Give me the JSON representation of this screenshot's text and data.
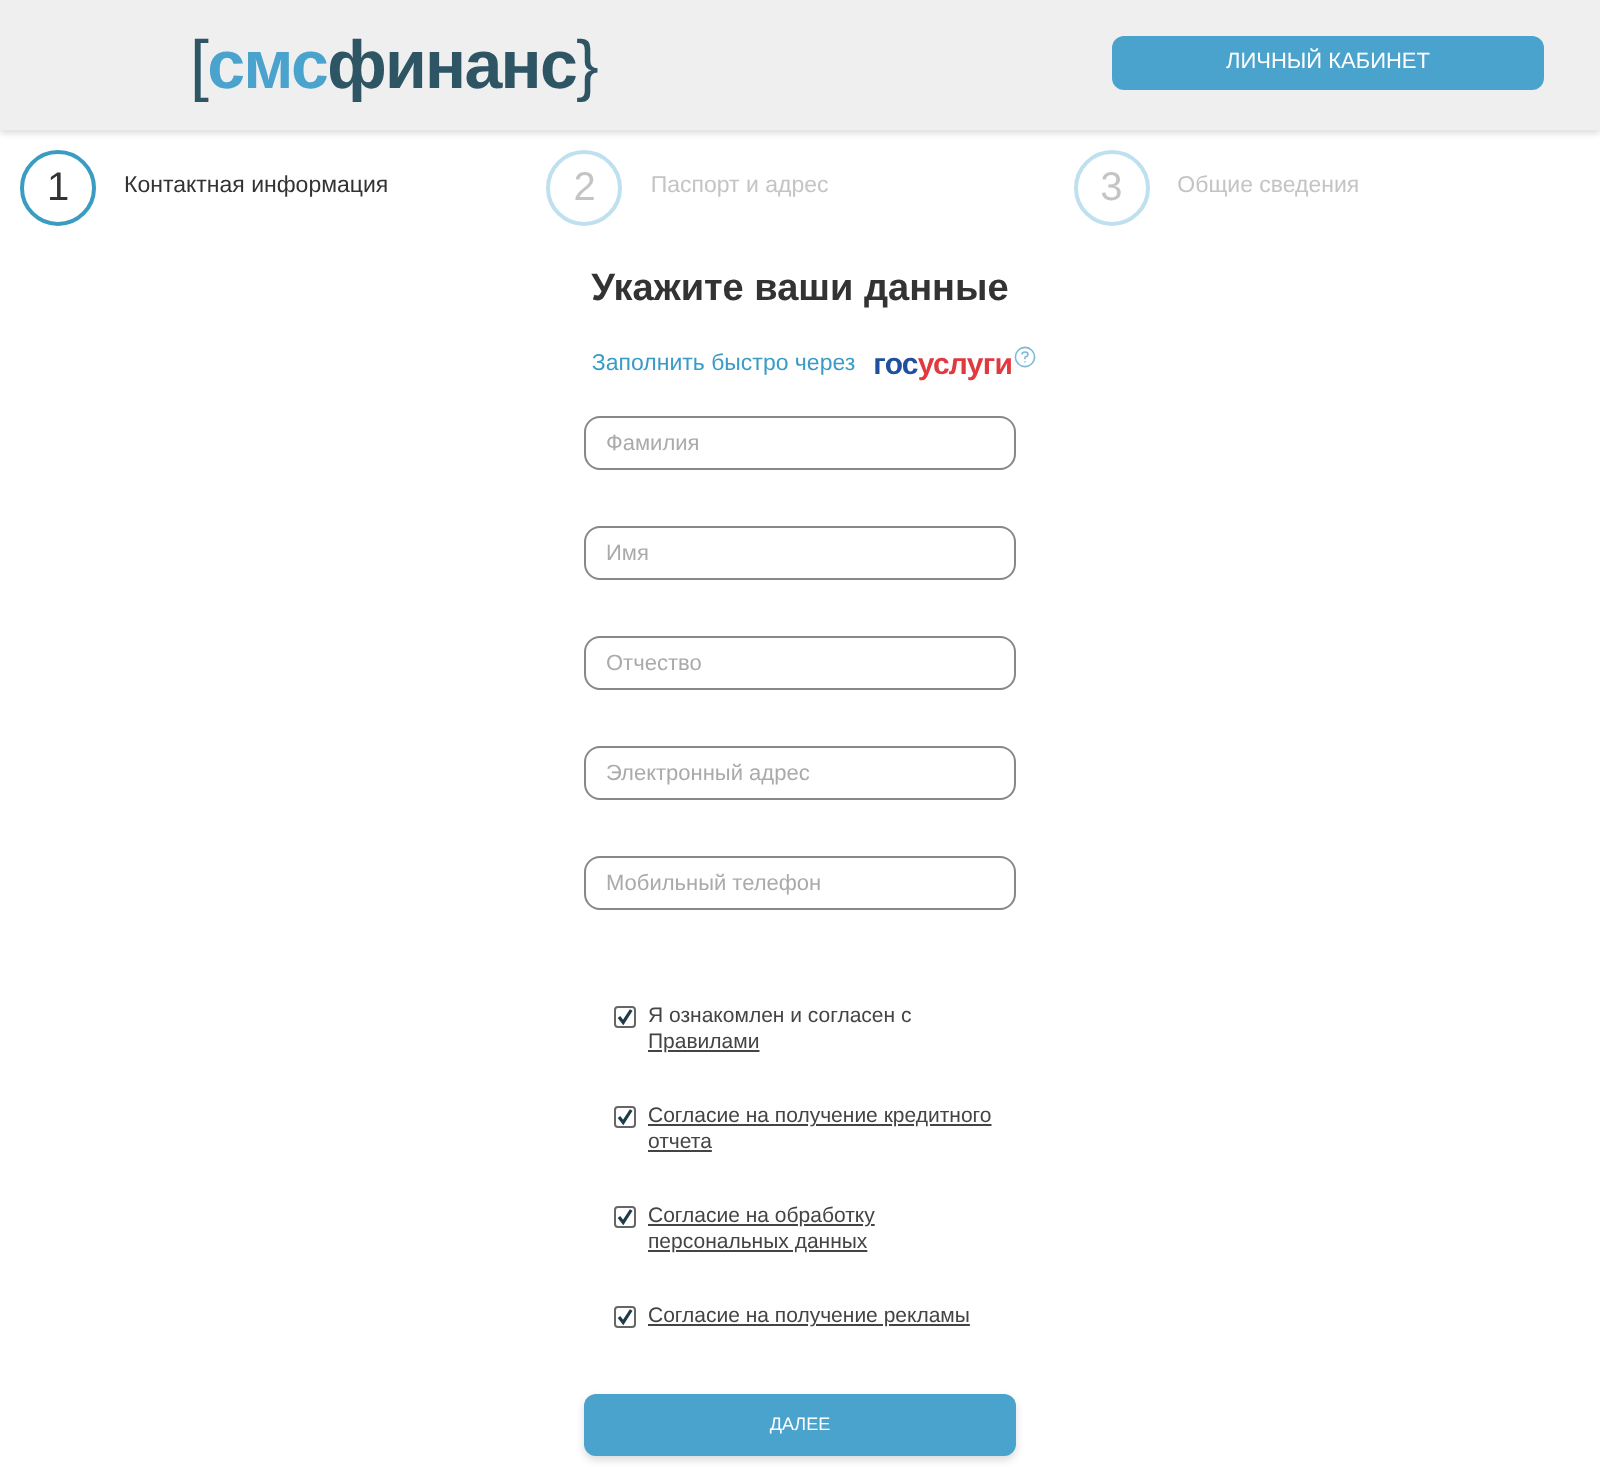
{
  "header": {
    "logo": {
      "left": "[",
      "accent": "смс",
      "main": "финанс",
      "right": "}"
    },
    "account_button": "ЛИЧНЫЙ КАБИНЕТ"
  },
  "steps": [
    {
      "number": "1",
      "label": "Контактная информация",
      "selected": true
    },
    {
      "number": "2",
      "label": "Паспорт и адрес",
      "selected": false
    },
    {
      "number": "3",
      "label": "Общие сведения",
      "selected": false
    }
  ],
  "form": {
    "title": "Укажите ваши данные",
    "gosuslugi": {
      "text": "Заполнить быстро через",
      "logo_first": "гос",
      "logo_second": "услуги"
    },
    "fields": [
      {
        "placeholder": "Фамилия"
      },
      {
        "placeholder": "Имя"
      },
      {
        "placeholder": "Отчество"
      },
      {
        "placeholder": "Электронный адрес"
      },
      {
        "placeholder": "Мобильный телефон"
      }
    ],
    "agreements": [
      {
        "text": "Я ознакомлен и согласен с",
        "link": "Правилами",
        "checked": true
      },
      {
        "link": "Согласие на получение кредитного отчета",
        "checked": true
      },
      {
        "link": "Согласие на обработку персональных данных",
        "checked": true
      },
      {
        "link": "Согласие на получение рекламы",
        "checked": true
      }
    ],
    "submit": "ДАЛЕЕ"
  }
}
